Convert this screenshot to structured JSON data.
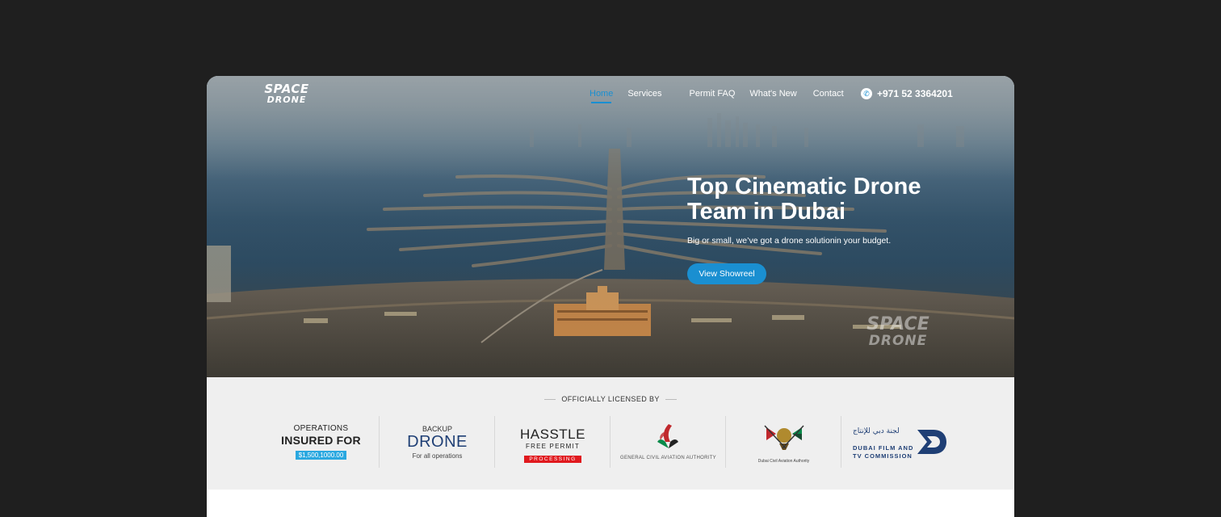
{
  "logo": {
    "line1": "SPACE",
    "line2": "DRONE"
  },
  "nav": {
    "items": [
      {
        "label": "Home"
      },
      {
        "label": "Services"
      },
      {
        "label": "Permit FAQ"
      },
      {
        "label": "What's New"
      },
      {
        "label": "Contact"
      }
    ]
  },
  "phone": {
    "number": "+971 52 3364201",
    "icon": "phone-icon"
  },
  "hero": {
    "title": "Top Cinematic Drone Team in Dubai",
    "subtitle": "Big or small, we’ve got a drone solutionin your budget.",
    "button_label": "View Showreel",
    "watermark_line1": "SPACE",
    "watermark_line2": "DRONE"
  },
  "licensed": {
    "title": "OFFICIALLY LICENSED BY",
    "logos": [
      {
        "line1": "OPERATIONS",
        "line2": "INSURED FOR",
        "line3": "$1,500,1000.00"
      },
      {
        "line1": "BACKUP",
        "line2": "DRONE",
        "line3": "For all operations"
      },
      {
        "line1": "HASSTLE",
        "line2": "FREE PERMIT",
        "line3": "PROCESSING"
      },
      {
        "line1": "GENERAL CIVIL AVIATION AUTHORITY"
      },
      {
        "line1": "Dubai Civil Aviation Authority"
      },
      {
        "line1": "DUBAI FILM AND",
        "line2": "TV COMMISSION"
      }
    ]
  },
  "colors": {
    "accent": "#1a8fd1",
    "background": "#1f1f1f",
    "strip": "#efefef",
    "badge_red": "#e0191e",
    "badge_blue": "#2aa8e0"
  }
}
